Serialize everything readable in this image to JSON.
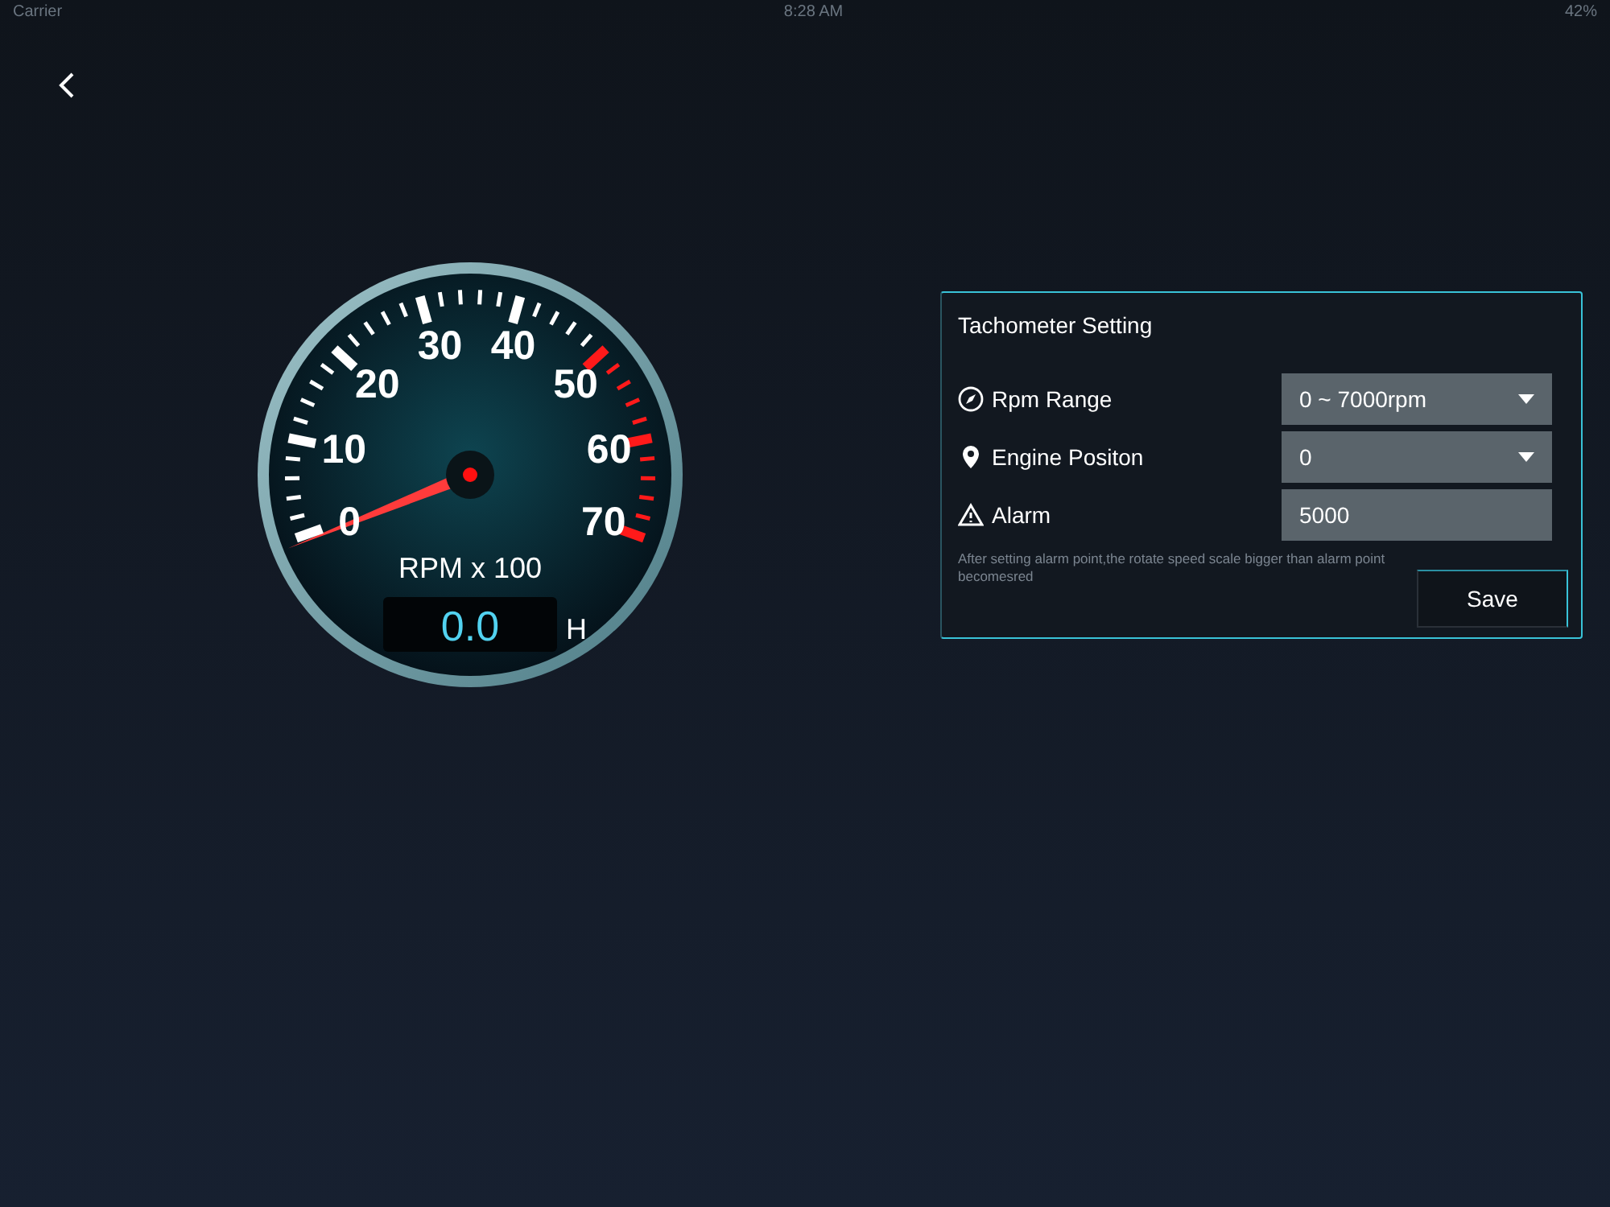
{
  "status_bar": {
    "carrier": "Carrier",
    "time": "8:28 AM",
    "battery": "42%"
  },
  "gauge": {
    "left_scale_labels": [
      "30",
      "20",
      "10",
      "0"
    ],
    "right_scale_labels": [
      "40",
      "50",
      "60",
      "70"
    ],
    "unit": "RPM x 100",
    "reading": "0.0",
    "hours_unit": "H"
  },
  "panel": {
    "title": "Tachometer Setting",
    "rows": [
      {
        "kind": "dropdown",
        "label": "Rpm Range",
        "value": "0 ~ 7000rpm"
      },
      {
        "kind": "dropdown",
        "label": "Engine Positon",
        "value": "0"
      },
      {
        "kind": "input",
        "label": "Alarm",
        "value": "5000"
      }
    ],
    "note": "After setting alarm point,the rotate speed scale bigger than alarm point becomesred",
    "save_button": "Save"
  }
}
